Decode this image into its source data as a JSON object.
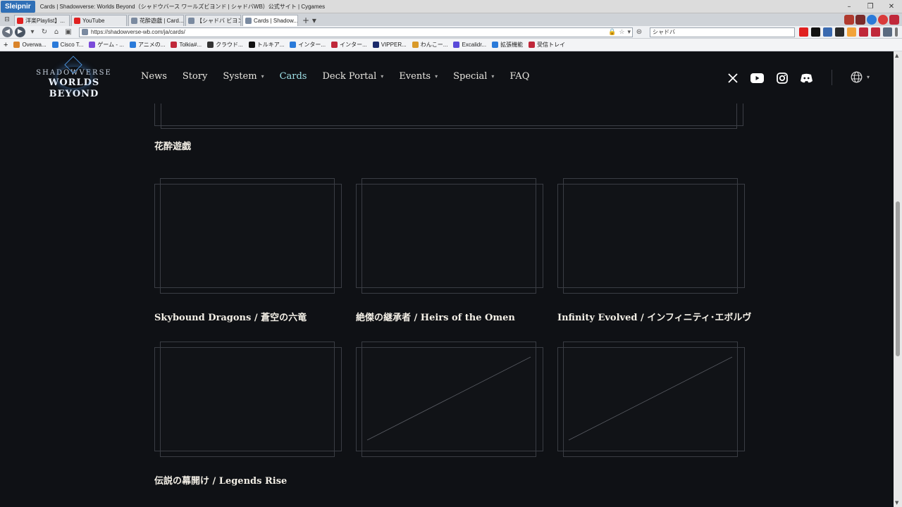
{
  "browser": {
    "app_name": "Sleipnir",
    "window_title": "Cards | Shadowverse: Worlds Beyond（シャドウバース ワールズビヨンド | シャドバWB）公式サイト | Cygames",
    "tabs": [
      {
        "label": "洋楽Playlist】...",
        "color": "#e02020",
        "active": false
      },
      {
        "label": "YouTube",
        "color": "#e02020",
        "active": false
      },
      {
        "label": "花酔遊戯 | Card...",
        "color": "#7a8aa0",
        "active": false
      },
      {
        "label": "【シャドバ ビヨンド】...",
        "color": "#7a8aa0",
        "active": false
      },
      {
        "label": "Cards | Shadow...",
        "color": "#7a8aa0",
        "active": true
      }
    ],
    "url": "https://shadowverse-wb.com/ja/cards/",
    "search_value": "シャドバ",
    "bookmarks": [
      {
        "label": "Overwa...",
        "color": "#d9832a"
      },
      {
        "label": "Cisco T...",
        "color": "#2a7ad9"
      },
      {
        "label": "ゲーム - ...",
        "color": "#7a4ad9"
      },
      {
        "label": "アニメの...",
        "color": "#2a7ad9"
      },
      {
        "label": "Tolkia#...",
        "color": "#c0283a"
      },
      {
        "label": "クラウド...",
        "color": "#333333"
      },
      {
        "label": "トルキア...",
        "color": "#111111"
      },
      {
        "label": "インター...",
        "color": "#2a7ad9"
      },
      {
        "label": "インター...",
        "color": "#c0283a"
      },
      {
        "label": "VIPPER...",
        "color": "#1a2a6a"
      },
      {
        "label": "わんこー...",
        "color": "#d99a2a"
      },
      {
        "label": "Excalidr...",
        "color": "#5a4ad9"
      },
      {
        "label": "拡張機能",
        "color": "#2a7ad9"
      },
      {
        "label": "受信トレイ",
        "color": "#c0283a"
      }
    ]
  },
  "site": {
    "logo_top": "SHADOWVERSE",
    "logo_bottom": "WORLDS BEYOND",
    "nav": [
      {
        "label": "News",
        "has_caret": false,
        "active": false
      },
      {
        "label": "Story",
        "has_caret": false,
        "active": false
      },
      {
        "label": "System",
        "has_caret": true,
        "active": false
      },
      {
        "label": "Cards",
        "has_caret": false,
        "active": true
      },
      {
        "label": "Deck Portal",
        "has_caret": true,
        "active": false
      },
      {
        "label": "Events",
        "has_caret": true,
        "active": false
      },
      {
        "label": "Special",
        "has_caret": true,
        "active": false
      },
      {
        "label": "FAQ",
        "has_caret": false,
        "active": false
      }
    ],
    "social_icons": [
      "x-icon",
      "youtube-icon",
      "instagram-icon",
      "discord-icon"
    ],
    "accent_color": "#9fe0e6"
  },
  "content": {
    "section_title": "花酔遊戯",
    "card_sets": [
      {
        "label": "Skybound Dragons / 蒼空の六竜",
        "placeholder": false
      },
      {
        "label": "絶傑の継承者 / Heirs of the Omen",
        "placeholder": false
      },
      {
        "label": "Infinity Evolved / インフィニティ･エボルヴ",
        "placeholder": false
      },
      {
        "label": "伝説の幕開け / Legends Rise",
        "placeholder": false
      },
      {
        "label": "",
        "placeholder": true
      },
      {
        "label": "",
        "placeholder": true
      }
    ]
  }
}
